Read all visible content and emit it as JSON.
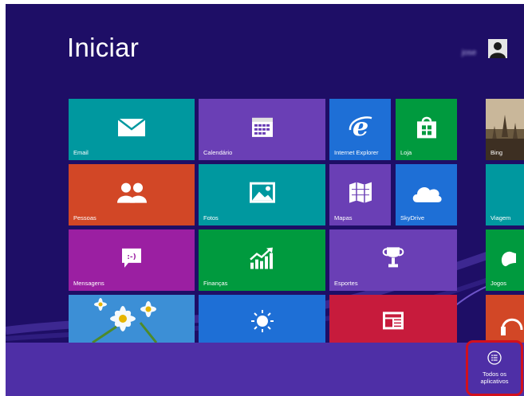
{
  "start": {
    "title": "Iniciar",
    "user_name": "jose"
  },
  "tiles": {
    "email": "Email",
    "calendario": "Calendário",
    "internet_explorer": "Internet Explorer",
    "loja": "Loja",
    "bing": "Bing",
    "pessoas": "Pessoas",
    "fotos": "Fotos",
    "mapas": "Mapas",
    "skydrive": "SkyDrive",
    "viagem": "Viagem",
    "mensagens": "Mensagens",
    "financas": "Finanças",
    "esportes": "Esportes",
    "jogos": "Jogos"
  },
  "all_apps": {
    "label_line1": "Todos os",
    "label_line2": "aplicativos"
  },
  "colors": {
    "background": "#1e0e66",
    "bottom_bar": "#4e2fa6",
    "highlight": "#d2101d",
    "teal": "#00989f",
    "orange": "#d24726",
    "purple": "#6a3fb5",
    "blue": "#1e6fd6",
    "green": "#009a3e",
    "magenta": "#9b1fa2",
    "red": "#c71b3c"
  },
  "icons": [
    "mail-icon",
    "calendar-icon",
    "ie-icon",
    "store-icon",
    "people-icon",
    "photos-icon",
    "maps-icon",
    "skydrive-icon",
    "messaging-icon",
    "finance-icon",
    "sports-trophy-icon",
    "games-controller-icon",
    "weather-sun-icon",
    "news-icon",
    "music-headphones-icon",
    "all-apps-icon",
    "user-avatar-icon"
  ]
}
